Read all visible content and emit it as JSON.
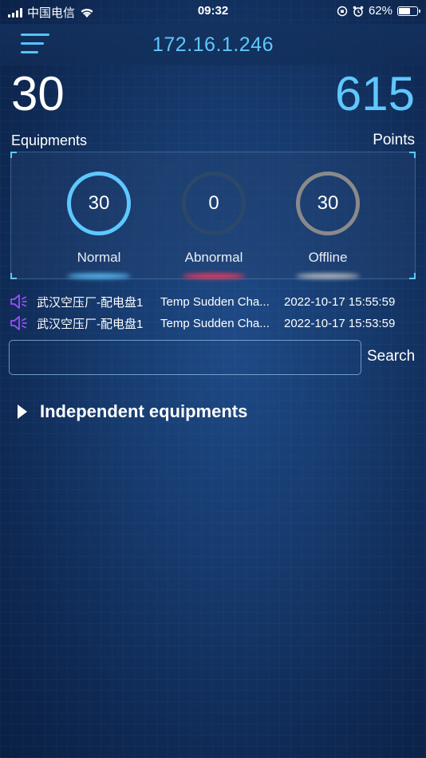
{
  "status_bar": {
    "carrier": "中国电信",
    "time": "09:32",
    "battery": "62%",
    "battery_level": 0.62
  },
  "header": {
    "menu_icon": "menu-icon",
    "title": "172.16.1.246"
  },
  "summary": {
    "equipments_count": "30",
    "equipments_label": "Equipments",
    "points_count": "615",
    "points_label": "Points"
  },
  "stats": [
    {
      "value": "30",
      "label": "Normal",
      "color": "#5ec8ff"
    },
    {
      "value": "0",
      "label": "Abnormal",
      "color": "#2b4868"
    },
    {
      "value": "30",
      "label": "Offline",
      "color": "#8a8a8a"
    }
  ],
  "alarms": [
    {
      "icon": "speaker-icon",
      "name": "武汉空压厂-配电盘1",
      "type": "Temp Sudden Cha...",
      "time": "2022-10-17 15:55:59"
    },
    {
      "icon": "speaker-icon",
      "name": "武汉空压厂-配电盘1",
      "type": "Temp Sudden Cha...",
      "time": "2022-10-17 15:53:59"
    }
  ],
  "search": {
    "value": "",
    "placeholder": "",
    "button_label": "Search"
  },
  "groups": [
    {
      "label": "Independent equipments",
      "expanded": false
    }
  ],
  "colors": {
    "accent": "#5ec8ff",
    "alarm_icon": "#9b4dff",
    "abnormal_glow": "#ff3b5c"
  }
}
